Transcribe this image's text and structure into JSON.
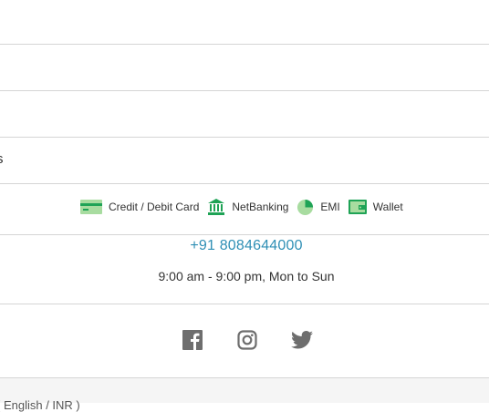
{
  "rows": {
    "partial_label": "s"
  },
  "payments": {
    "items": [
      {
        "label": "Credit / Debit Card",
        "icon": "credit-card-icon"
      },
      {
        "label": "NetBanking",
        "icon": "bank-icon"
      },
      {
        "label": "EMI",
        "icon": "pie-chart-icon"
      },
      {
        "label": "Wallet",
        "icon": "wallet-icon"
      }
    ],
    "icon_color": "#1fa356",
    "icon_light": "#a8dca0"
  },
  "contact": {
    "phone": "+91 8084644000",
    "hours": "9:00 am - 9:00 pm, Mon to Sun",
    "phone_color": "#2f8fb5"
  },
  "social": {
    "icons": [
      "facebook-icon",
      "instagram-icon",
      "twitter-icon"
    ],
    "icon_color": "#6e6e6e"
  },
  "footer": {
    "locale_text": "( English / INR )"
  }
}
